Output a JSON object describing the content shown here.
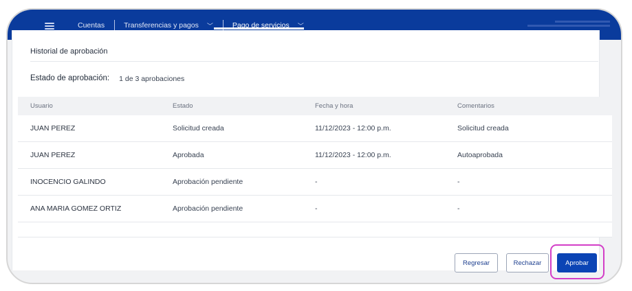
{
  "topbar": {
    "nav": [
      {
        "label": "Cuentas",
        "has_dropdown": false
      },
      {
        "label": "Transferencias y pagos",
        "has_dropdown": true
      },
      {
        "label": "Pago de servicios",
        "has_dropdown": true,
        "active": true
      }
    ]
  },
  "history": {
    "title": "Historial de aprobación",
    "status_label": "Estado de aprobación:",
    "status_value": "1 de 3 aprobaciones"
  },
  "table": {
    "headers": [
      "Usuario",
      "Estado",
      "Fecha y hora",
      "Comentarios"
    ],
    "rows": [
      [
        "JUAN PEREZ",
        "Solicitud creada",
        "11/12/2023 - 12:00 p.m.",
        "Solicitud creada"
      ],
      [
        "JUAN PEREZ",
        "Aprobada",
        "11/12/2023 - 12:00 p.m.",
        "Autoaprobada"
      ],
      [
        "INOCENCIO GALINDO",
        "Aprobación pendiente",
        "-",
        "-"
      ],
      [
        "ANA MARIA GOMEZ ORTIZ",
        "Aprobación pendiente",
        "-",
        "-"
      ]
    ]
  },
  "actions": {
    "back": "Regresar",
    "reject": "Rechazar",
    "approve": "Aprobar"
  },
  "colors": {
    "brand": "#0a3b9c",
    "primary_button": "#0b44b5",
    "highlight": "#d33ec7"
  }
}
